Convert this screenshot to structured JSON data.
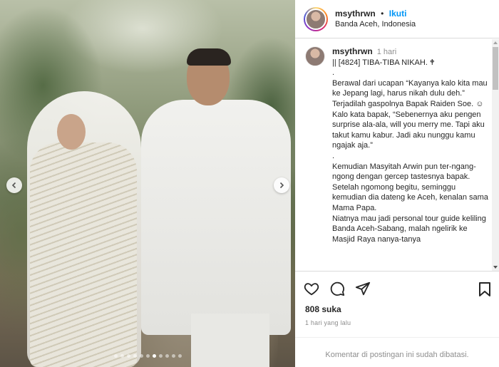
{
  "post": {
    "username": "msythrwn",
    "separator": "•",
    "follow_label": "Ikuti",
    "location": "Banda Aceh, Indonesia",
    "caption_time": "1 hari",
    "caption_lines": [
      "|| [4824] TIBA-TIBA NIKAH. 🕈",
      ".",
      "Berawal dari ucapan “Kayanya kalo kita mau ke Jepang lagi, harus nikah dulu deh.” Terjadilah gaspolnya Bapak Raiden Soe. ☺",
      "Kalo kata bapak, “Sebenernya aku pengen surprise ala-ala, will you merry me. Tapi aku takut kamu kabur. Jadi aku nunggu kamu ngajak aja.”",
      ".",
      "Kemudian Masyitah Arwin pun ter-ngang-ngong dengan gercep tastesnya bapak.",
      "Setelah ngomong begitu, seminggu kemudian dia dateng ke Aceh, kenalan sama Mama Papa.",
      "Niatnya mau jadi personal tour guide keliling Banda Aceh-Sabang, malah ngelirik ke Masjid Raya nanya-tanya"
    ],
    "likes": "808 suka",
    "time_ago": "1 hari yang lalu",
    "comments_disabled": "Komentar di postingan ini sudah dibatasi.",
    "carousel": {
      "total": 11,
      "active_index": 6
    }
  },
  "icons": {
    "prev": "chevron-left-icon",
    "next": "chevron-right-icon",
    "like": "heart-icon",
    "comment": "comment-icon",
    "share": "send-icon",
    "save": "bookmark-icon"
  },
  "colors": {
    "link": "#0095f6",
    "text": "#262626",
    "muted": "#8e8e8e",
    "border": "#dbdbdb"
  }
}
